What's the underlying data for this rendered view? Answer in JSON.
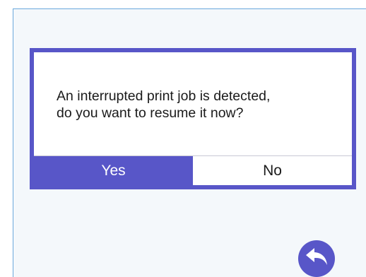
{
  "dialog": {
    "message": "An interrupted print job is detected,\ndo you want to resume it now?",
    "yes_label": "Yes",
    "no_label": "No"
  },
  "icons": {
    "back": "back-arrow-icon"
  },
  "colors": {
    "accent": "#5856c8",
    "background": "#f4f8fb",
    "frame_border": "#6aa8dc"
  }
}
